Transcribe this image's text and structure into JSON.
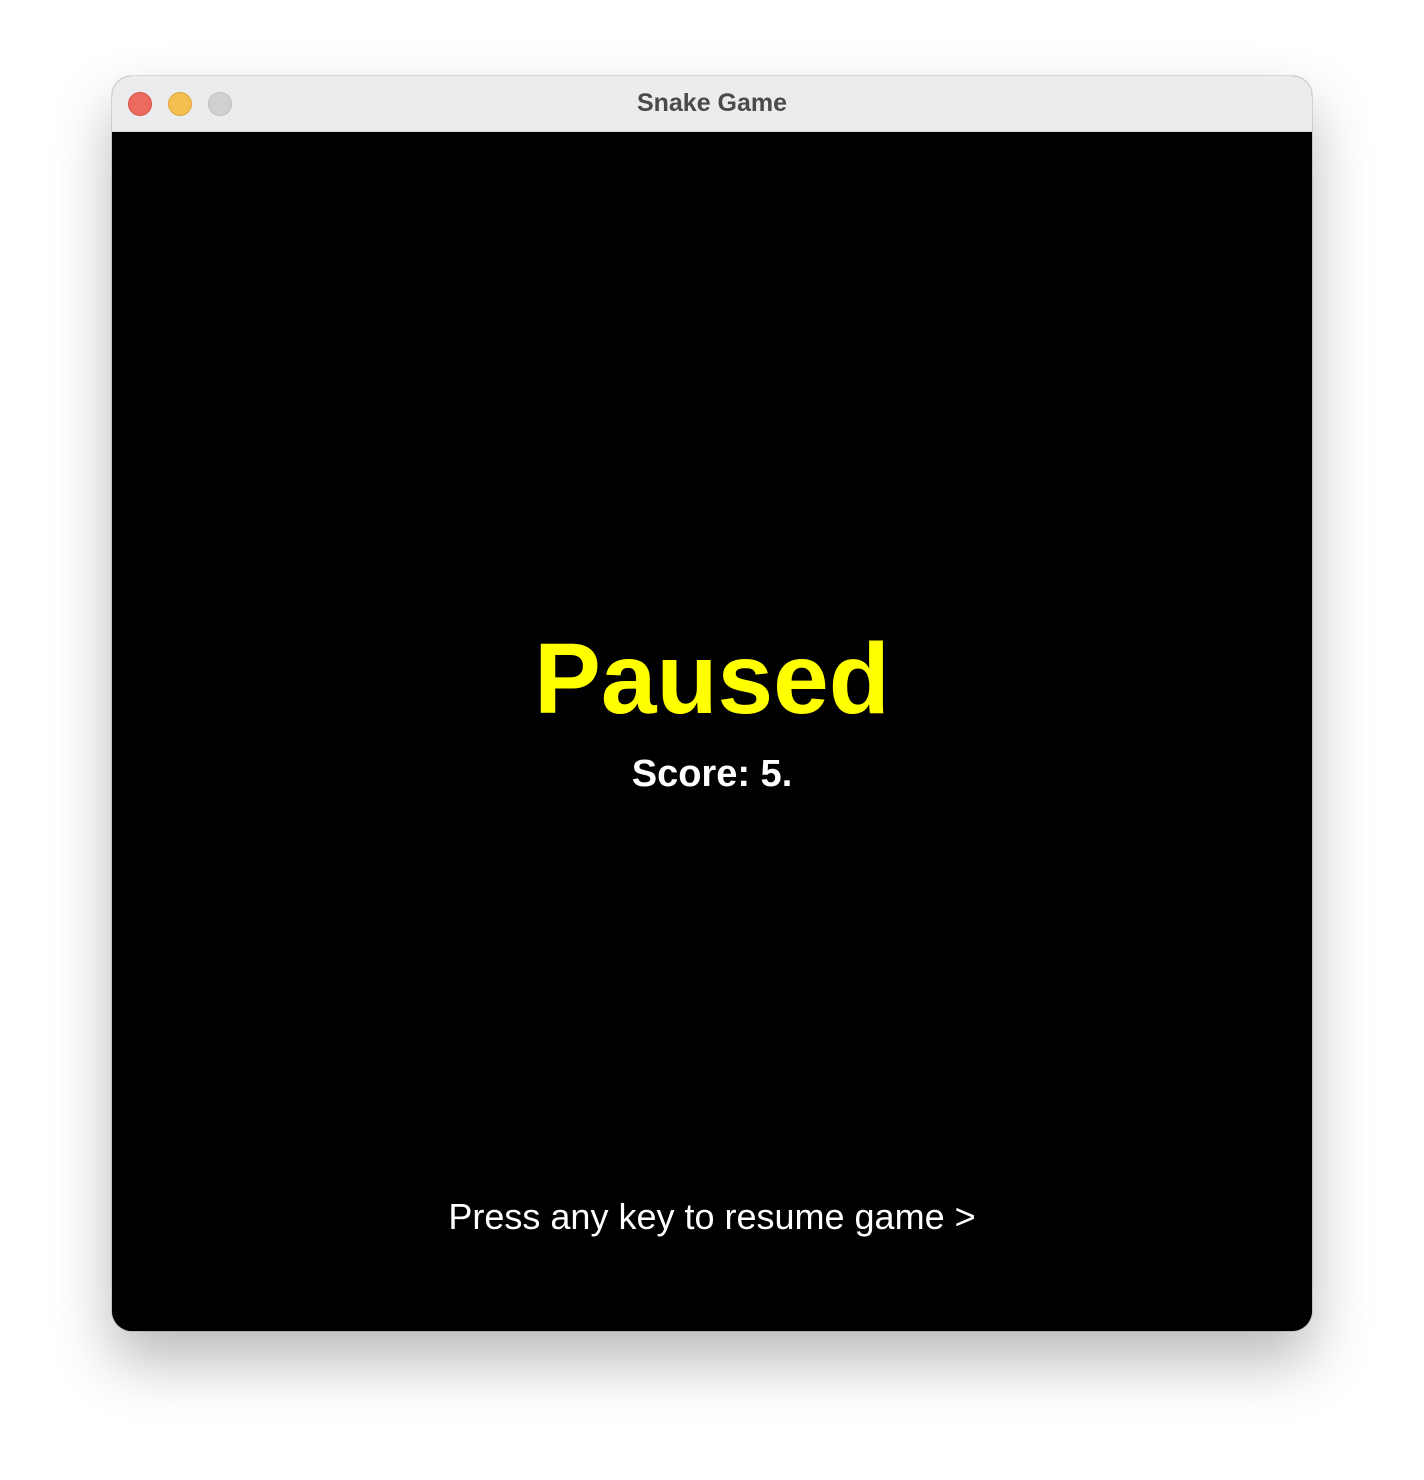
{
  "window": {
    "title": "Snake Game",
    "controls": {
      "close": "close-button",
      "minimize": "minimize-button",
      "maximize": "zoom-button"
    }
  },
  "game": {
    "state_label": "Paused",
    "score_text": "Score: 5.",
    "prompt_text": "Press any key to resume game >"
  },
  "colors": {
    "background": "#000000",
    "state_label": "#ffff00",
    "text": "#ffffff",
    "titlebar": "#ececee"
  }
}
